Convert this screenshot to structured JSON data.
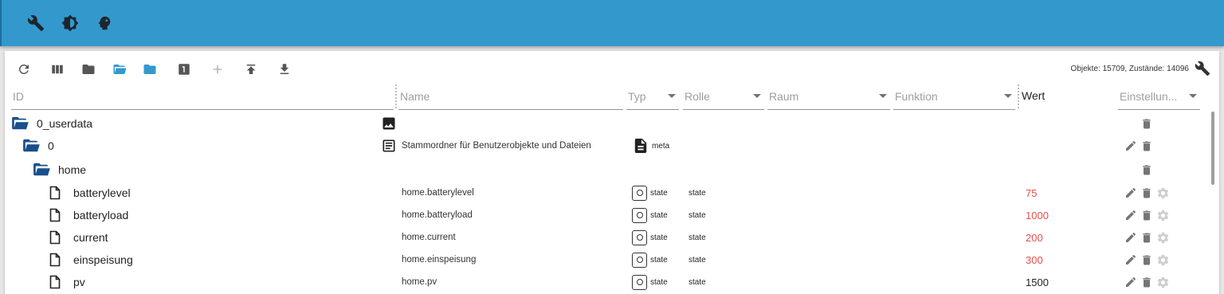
{
  "appbar": {
    "icons": [
      "wrench-icon",
      "brightness-icon",
      "head-icon"
    ]
  },
  "toolbar": {
    "icons": [
      "refresh-icon",
      "columns-icon",
      "folder-closed-icon",
      "folder-open-icon",
      "folder-blue-icon",
      "number-one-icon",
      "add-icon",
      "upload-icon",
      "download-icon"
    ],
    "counts_text": "Objekte: 15709, Zustände: 14096"
  },
  "columns": {
    "id": "ID",
    "name": "Name",
    "typ": "Typ",
    "rolle": "Rolle",
    "raum": "Raum",
    "funktion": "Funktion",
    "wert": "Wert",
    "einstellungen": "Einstellun..."
  },
  "colors": {
    "appbar": "#3399cc",
    "folder": "#1a4f8a",
    "value_red": "#e84c4c"
  },
  "rows": [
    {
      "id": "0_userdata",
      "kind": "folder",
      "name": "",
      "name_icon": "image-icon",
      "typ": "",
      "typ_icon": "",
      "rolle": "",
      "wert": "",
      "wert_color": "",
      "actions": [
        "delete"
      ]
    },
    {
      "id": "0",
      "kind": "folder",
      "name": "Stammordner für Benutzerobjekte und Dateien",
      "name_icon": "notes-icon",
      "typ": "meta",
      "typ_icon": "document-icon",
      "rolle": "",
      "wert": "",
      "wert_color": "",
      "actions": [
        "edit",
        "delete"
      ]
    },
    {
      "id": "home",
      "kind": "folder",
      "name": "",
      "name_icon": "",
      "typ": "",
      "typ_icon": "",
      "rolle": "",
      "wert": "",
      "wert_color": "",
      "actions": [
        "delete"
      ]
    },
    {
      "id": "batterylevel",
      "kind": "file",
      "name": "home.batterylevel",
      "name_icon": "",
      "typ": "state",
      "typ_icon": "state-icon",
      "rolle": "state",
      "wert": "75",
      "wert_color": "red",
      "actions": [
        "edit",
        "delete",
        "settings"
      ]
    },
    {
      "id": "batteryload",
      "kind": "file",
      "name": "home.batteryload",
      "name_icon": "",
      "typ": "state",
      "typ_icon": "state-icon",
      "rolle": "state",
      "wert": "1000",
      "wert_color": "red",
      "actions": [
        "edit",
        "delete",
        "settings"
      ]
    },
    {
      "id": "current",
      "kind": "file",
      "name": "home.current",
      "name_icon": "",
      "typ": "state",
      "typ_icon": "state-icon",
      "rolle": "state",
      "wert": "200",
      "wert_color": "red",
      "actions": [
        "edit",
        "delete",
        "settings"
      ]
    },
    {
      "id": "einspeisung",
      "kind": "file",
      "name": "home.einspeisung",
      "name_icon": "",
      "typ": "state",
      "typ_icon": "state-icon",
      "rolle": "state",
      "wert": "300",
      "wert_color": "red",
      "actions": [
        "edit",
        "delete",
        "settings"
      ]
    },
    {
      "id": "pv",
      "kind": "file",
      "name": "home.pv",
      "name_icon": "",
      "typ": "state",
      "typ_icon": "state-icon",
      "rolle": "state",
      "wert": "1500",
      "wert_color": "black",
      "actions": [
        "edit",
        "delete",
        "settings"
      ]
    }
  ]
}
